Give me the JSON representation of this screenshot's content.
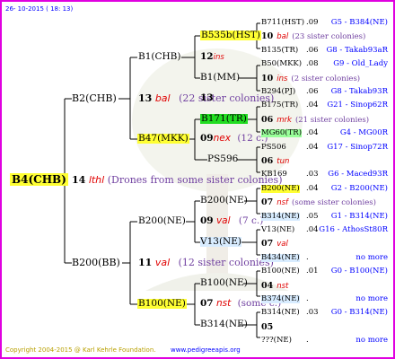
{
  "header": {
    "date": "26- 10-2015 ( 18: 13)"
  },
  "root": {
    "name": "B4(CHB)",
    "year": "14",
    "code": "lthl",
    "note": "(Drones from some sister colonies)"
  },
  "gen1": {
    "father": {
      "name": "B2(CHB)",
      "year": "13",
      "code": "bal",
      "note": "(22 sister colonies)"
    },
    "mother": {
      "name": "B200(BB)",
      "year": "11",
      "code": "val",
      "note": "(12 sister colonies)"
    }
  },
  "gen2": {
    "b1": {
      "name": "B1(CHB)"
    },
    "b47": {
      "name": "B47(MKK)",
      "year": "09",
      "code": "nex",
      "note": "(12 c.)"
    },
    "b200ne": {
      "name": "B200(NE)",
      "year": "09",
      "code": "val",
      "note": "(7 c.)"
    },
    "b100ne": {
      "name": "B100(NE)",
      "year": "07",
      "code": "nst",
      "note": "(some c.)"
    }
  },
  "gen3": [
    {
      "name": "B535b(HST)",
      "year": "12",
      "code": "ins"
    },
    {
      "name": "B1(MM)",
      "year": "13"
    },
    {
      "name": "B171(TR)"
    },
    {
      "name": "PS596"
    },
    {
      "name": "B200(NE)"
    },
    {
      "name": "V13(NE)"
    },
    {
      "name": "B100(NE)"
    },
    {
      "name": "B314(NE)"
    }
  ],
  "gen4": [
    {
      "name": "B711(HST)",
      "year": ".09",
      "ref": "G5 - B384(NE)",
      "hl": ""
    },
    {
      "line": true,
      "year": "10",
      "code": "bal",
      "note": "(23 sister colonies)"
    },
    {
      "name": "B135(TR)",
      "year": ".06",
      "ref": "G8 - Takab93aR",
      "hl": ""
    },
    {
      "name": "B50(MKK)",
      "year": ".08",
      "ref": "G9 - Old_Lady",
      "hl": ""
    },
    {
      "line": true,
      "year": "10",
      "code": "ins",
      "note": "(2 sister colonies)"
    },
    {
      "name": "B294(PJ)",
      "year": ".06",
      "ref": "G8 - Takab93R",
      "hl": ""
    },
    {
      "name": "B175(TR)",
      "year": ".04",
      "ref": "G21 - Sinop62R",
      "hl": ""
    },
    {
      "line": true,
      "year": "06",
      "code": "mrk",
      "note": "(21 sister colonies)"
    },
    {
      "name": "MG60(TR)",
      "year": ".04",
      "ref": "G4 - MG00R",
      "hl": "lgrn"
    },
    {
      "name": "PS506",
      "year": ".04",
      "ref": "G17 - Sinop72R",
      "hl": ""
    },
    {
      "line": true,
      "year": "06",
      "code": "tun",
      "note": ""
    },
    {
      "name": "KB169",
      "year": ".03",
      "ref": "G6 - Maced93R",
      "hl": ""
    },
    {
      "name": "B200(NE)",
      "year": ".04",
      "ref": "G2 - B200(NE)",
      "hl": "ylw"
    },
    {
      "line": true,
      "year": "07",
      "code": "nsf",
      "note": "(some sister colonies)"
    },
    {
      "name": "B314(NE)",
      "year": ".05",
      "ref": "G1 - B314(NE)",
      "hl": "lblue"
    },
    {
      "name": "V13(NE)",
      "year": ".04",
      "ref": "G16 - AthosSt80R",
      "hl": ""
    },
    {
      "line": true,
      "year": "07",
      "code": "val",
      "note": ""
    },
    {
      "name": "B434(NE)",
      "year": ".",
      "ref": "no more",
      "hl": "lblue"
    },
    {
      "name": "B100(NE)",
      "year": ".01",
      "ref": "G0 - B100(NE)",
      "hl": ""
    },
    {
      "line": true,
      "year": "04",
      "code": "nst",
      "note": ""
    },
    {
      "name": "B374(NE)",
      "year": ".",
      "ref": "no more",
      "hl": "lblue"
    },
    {
      "name": "B314(NE)",
      "year": ".03",
      "ref": "G0 - B314(NE)",
      "hl": ""
    },
    {
      "line": true,
      "year": "05",
      "code": "",
      "note": ""
    },
    {
      "name": "???(NE)",
      "year": ".",
      "ref": "no more",
      "hl": ""
    }
  ],
  "footer": {
    "copyright": "Copyright 2004-2015 @ Karl Kehrle Foundation.",
    "website": "www.pedigreeapis.org"
  }
}
